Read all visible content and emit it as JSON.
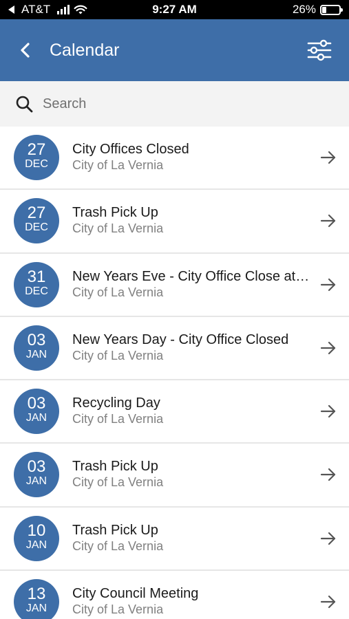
{
  "status_bar": {
    "carrier": "AT&T",
    "time": "9:27 AM",
    "battery_pct_label": "26%",
    "battery_level": 0.26
  },
  "nav": {
    "title": "Calendar",
    "back_icon": "chevron-left-icon",
    "filter_icon": "sliders-icon",
    "color": "#3e6ea8"
  },
  "search": {
    "placeholder": "Search",
    "value": ""
  },
  "events": [
    {
      "day": "27",
      "month": "DEC",
      "title": "City Offices Closed",
      "org": "City of La Vernia"
    },
    {
      "day": "27",
      "month": "DEC",
      "title": "Trash Pick Up",
      "org": "City of La Vernia"
    },
    {
      "day": "31",
      "month": "DEC",
      "title": "New Years Eve - City Office Close at…",
      "org": "City of La Vernia"
    },
    {
      "day": "03",
      "month": "JAN",
      "title": "New Years Day - City Office Closed",
      "org": "City of La Vernia"
    },
    {
      "day": "03",
      "month": "JAN",
      "title": "Recycling Day",
      "org": "City of La Vernia"
    },
    {
      "day": "03",
      "month": "JAN",
      "title": "Trash Pick Up",
      "org": "City of La Vernia"
    },
    {
      "day": "10",
      "month": "JAN",
      "title": "Trash Pick Up",
      "org": "City of La Vernia"
    },
    {
      "day": "13",
      "month": "JAN",
      "title": "City Council Meeting",
      "org": "City of La Vernia"
    }
  ]
}
